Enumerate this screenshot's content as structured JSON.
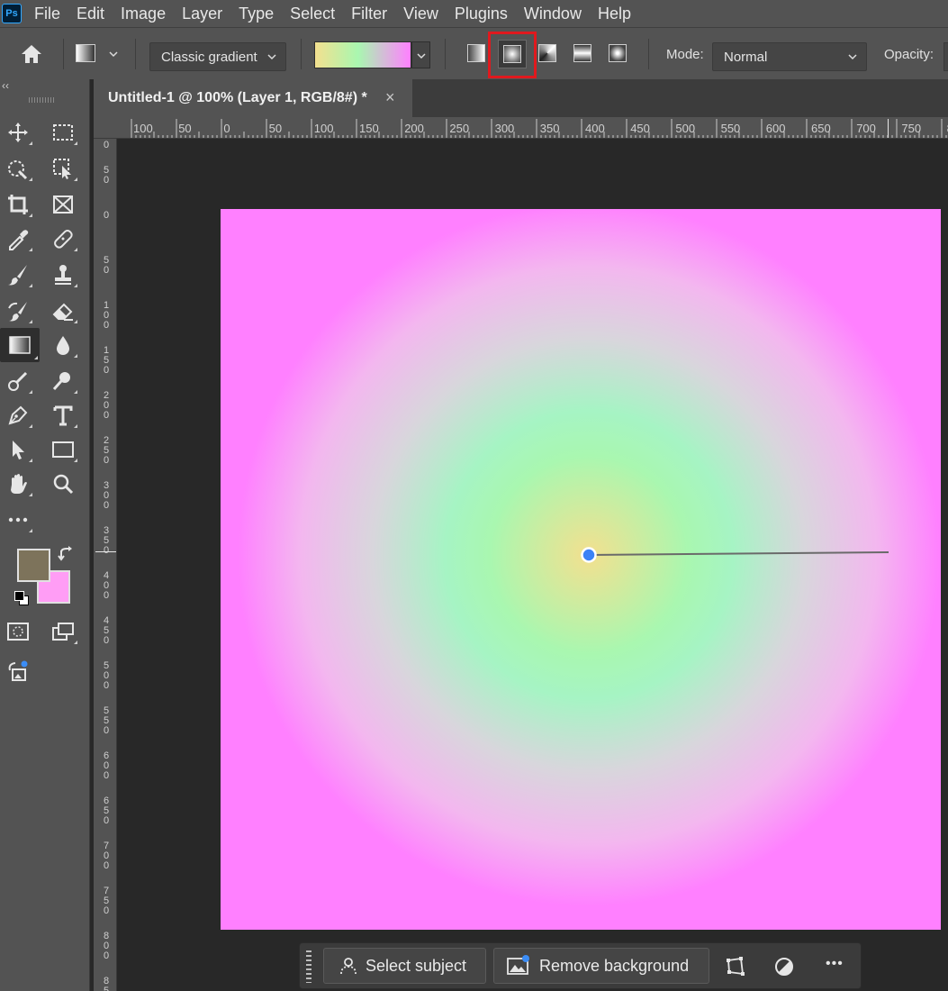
{
  "app": {
    "logo_text": "Ps"
  },
  "menu": [
    "File",
    "Edit",
    "Image",
    "Layer",
    "Type",
    "Select",
    "Filter",
    "View",
    "Plugins",
    "Window",
    "Help"
  ],
  "options": {
    "gradient_style": "Classic gradient",
    "gradient_colors": [
      "#f3e08f",
      "#a9f7b0",
      "#ff80ff"
    ],
    "selected_shape": "radial-gradient",
    "mode_label": "Mode:",
    "mode_value": "Normal",
    "opacity_label": "Opacity:",
    "highlight_color": "#e0191e"
  },
  "toolbar": {
    "collapse_glyph": "‹‹",
    "foreground_color": "#7d735b",
    "background_color": "#ff9df5"
  },
  "document": {
    "tab_title": "Untitled-1 @ 100% (Layer 1, RGB/8#) *",
    "close_glyph": "×"
  },
  "ruler": {
    "horizontal": [
      "100",
      "50",
      "0",
      "50",
      "100",
      "150",
      "200",
      "250",
      "300",
      "350",
      "400",
      "450",
      "500",
      "550",
      "600",
      "650",
      "700",
      "750",
      "8"
    ],
    "vertical": [
      "0",
      "50",
      "0",
      "50",
      "100",
      "150",
      "200",
      "250",
      "300",
      "350",
      "400",
      "450",
      "500",
      "550",
      "600",
      "650",
      "700",
      "750",
      "800",
      "85"
    ]
  },
  "context_bar": {
    "select_subject": "Select subject",
    "remove_background": "Remove background",
    "more_glyph": "•••"
  }
}
